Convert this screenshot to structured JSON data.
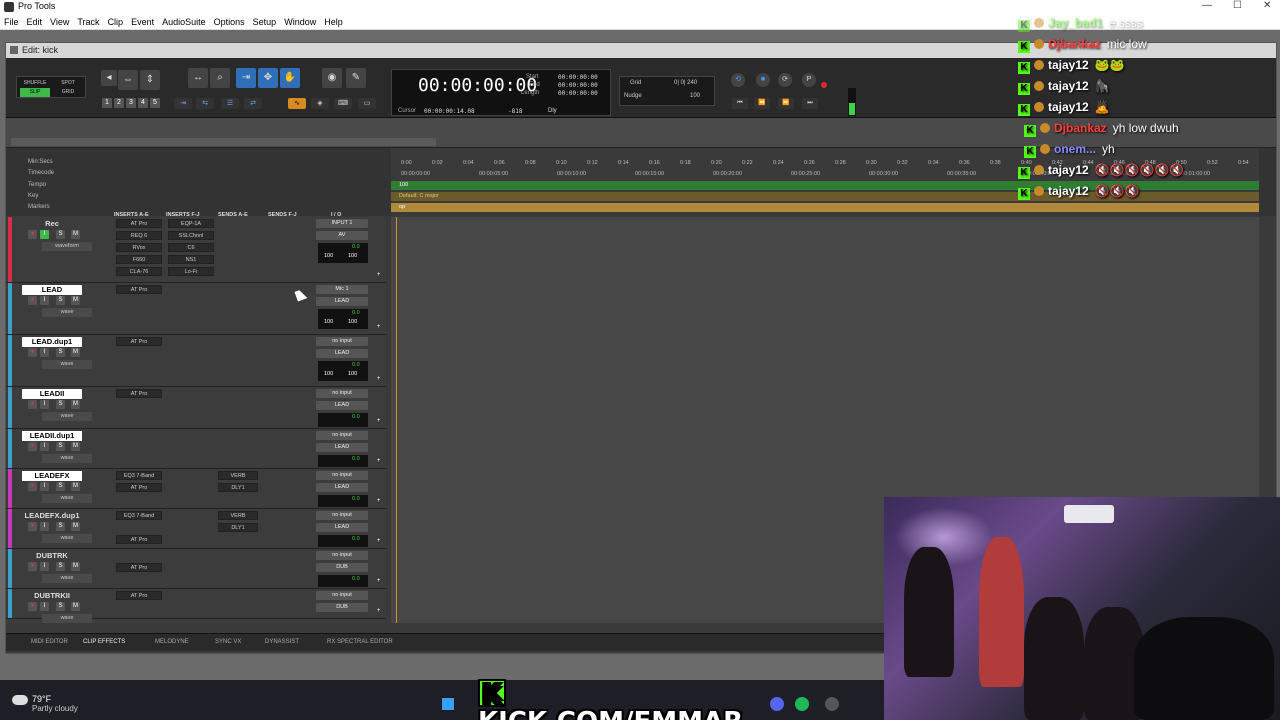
{
  "window": {
    "title": "Pro Tools",
    "minimize": "—",
    "maximize": "☐",
    "close": "✕"
  },
  "menu": [
    "File",
    "Edit",
    "View",
    "Track",
    "Clip",
    "Event",
    "AudioSuite",
    "Options",
    "Setup",
    "Window",
    "Help"
  ],
  "edit_window": {
    "title": "Edit: kick"
  },
  "modes": {
    "shuffle": "SHUFFLE",
    "spot": "SPOT",
    "slip": "SLIP",
    "grid": "GRID"
  },
  "zoom_presets": [
    "1",
    "2",
    "3",
    "4",
    "5"
  ],
  "counter": {
    "main": "00:00:00:00",
    "start_label": "Start",
    "start": "00:00:00:00",
    "end_label": "End",
    "end": "00:00:00:00",
    "length_label": "Length",
    "length": "00:00:00:00",
    "cursor_label": "Cursor",
    "cursor": "00:00:00:14.08",
    "cursor_extra": "-818",
    "dly": "Dly"
  },
  "grid": {
    "label": "Grid",
    "value": "0| 0| 240",
    "nudge_label": "Nudge",
    "nudge_value": "100"
  },
  "rulers": {
    "minsecs": "Min:Secs",
    "timecode": "Timecode",
    "tempo": "Tempo",
    "key": "Key",
    "markers": "Markers"
  },
  "timeline": {
    "minsecs_ticks": [
      "0:00",
      "0:02",
      "0:04",
      "0:06",
      "0:08",
      "0:10",
      "0:12",
      "0:14",
      "0:16",
      "0:18",
      "0:20",
      "0:22",
      "0:24",
      "0:26",
      "0:28",
      "0:30",
      "0:32",
      "0:34",
      "0:36",
      "0:38",
      "0:40",
      "0:42",
      "0:44",
      "0:46",
      "0:48",
      "0:50",
      "0:52",
      "0:54"
    ],
    "timecode_ticks": [
      "00:00:00:00",
      "00:00:05:00",
      "00:00:10:00",
      "00:00:15:00",
      "00:00:20:00",
      "00:00:25:00",
      "00:00:30:00",
      "00:00:35:00",
      "00:00:40:00",
      "00:00:55:00",
      "00:01:00:00"
    ],
    "tempo_value": "100",
    "key_value": "Default: C major",
    "marker_value": "op"
  },
  "columns": {
    "inserts_ae": "INSERTS A-E",
    "inserts_fj": "INSERTS F-J",
    "sends_ae": "SENDS A-E",
    "sends_fj": "SENDS F-J",
    "io": "I / O"
  },
  "tracks": [
    {
      "name": "Rec",
      "color": "#d92b4a",
      "ins_a": [
        "AT Pro",
        "REQ 6",
        "RVox",
        "F660",
        "CLA-76"
      ],
      "ins_f": [
        "EQP-1A",
        "SSLChnnl",
        "C6",
        "NS1",
        "Lo-Fi"
      ],
      "sends": [
        "",
        ""
      ],
      "io_in": "INPUT 1",
      "io_out": "AV",
      "vol": "0.0",
      "pan_l": "100",
      "pan_r": "100",
      "view": "waveform",
      "auto": "read",
      "dyn": "dyn",
      "plain": true
    },
    {
      "name": "LEAD",
      "color": "#3aa0c8",
      "ins_a": [
        "AT Pro"
      ],
      "ins_f": [],
      "sends": [
        "",
        ""
      ],
      "io_in": "Mic 1",
      "io_out": "LEAD",
      "vol": "0.0",
      "pan_l": "100",
      "pan_r": "100",
      "view": "wave",
      "auto": "read",
      "plain": false
    },
    {
      "name": "LEAD.dup1",
      "color": "#3aa0c8",
      "ins_a": [
        "AT Pro"
      ],
      "ins_f": [],
      "sends": [
        "",
        ""
      ],
      "io_in": "no input",
      "io_out": "LEAD",
      "vol": "0.0",
      "pan_l": "100",
      "pan_r": "100",
      "view": "wave",
      "auto": "read",
      "plain": false
    },
    {
      "name": "LEADII",
      "color": "#3aa0c8",
      "ins_a": [
        "AT Pro"
      ],
      "ins_f": [],
      "sends": [
        "",
        ""
      ],
      "io_in": "no input",
      "io_out": "LEAD",
      "vol": "0.0",
      "pan_l": "P",
      "pan_r": "P",
      "view": "wave",
      "auto": "read",
      "plain": false
    },
    {
      "name": "LEADII.dup1",
      "color": "#3aa0c8",
      "ins_a": [],
      "ins_f": [],
      "sends": [
        "",
        ""
      ],
      "io_in": "no input",
      "io_out": "LEAD",
      "vol": "0.0",
      "pan_l": "<",
      "pan_r": "0",
      "view": "wave",
      "auto": "read",
      "plain": false
    },
    {
      "name": "LEADEFX",
      "color": "#c83ab8",
      "ins_a": [
        "EQ3 7-Band",
        "AT Pro"
      ],
      "ins_f": [],
      "sends": [
        "VERB",
        "DLY1"
      ],
      "io_in": "no input",
      "io_out": "LEAD",
      "vol": "0.0",
      "pan_l": "P",
      "pan_r": "P",
      "view": "wave",
      "auto": "read",
      "plain": false
    },
    {
      "name": "LEADEFX.dup1",
      "color": "#c83ab8",
      "ins_a": [
        "EQ3 7-Band",
        "",
        "AT Pro"
      ],
      "ins_f": [],
      "sends": [
        "VERB",
        "DLY1"
      ],
      "io_in": "no input",
      "io_out": "LEAD",
      "vol": "0.0",
      "pan_l": "P",
      "pan_r": "P",
      "view": "wave",
      "auto": "read",
      "plain": true
    },
    {
      "name": "DUBTRK",
      "color": "#3aa0c8",
      "ins_a": [
        "",
        "AT Pro"
      ],
      "ins_f": [],
      "sends": [
        "",
        ""
      ],
      "io_in": "no input",
      "io_out": "DUB",
      "vol": "0.0",
      "pan_l": "P",
      "pan_r": "P",
      "view": "wave",
      "auto": "read",
      "plain": true
    },
    {
      "name": "DUBTRKII",
      "color": "#3aa0c8",
      "ins_a": [
        "AT Pro"
      ],
      "ins_f": [],
      "sends": [
        "",
        ""
      ],
      "io_in": "no input",
      "io_out": "DUB",
      "vol": "",
      "pan_l": "",
      "pan_r": "",
      "view": "wave",
      "auto": "read",
      "plain": true
    }
  ],
  "footer_tabs": [
    "MIDI EDITOR",
    "CLIP EFFECTS",
    "MELODYNE",
    "SYNC VX",
    "DYNASSIST",
    "RX SPECTRAL EDITOR"
  ],
  "chat": [
    {
      "user": "Jay_bad1",
      "msg": "e.ssss",
      "color": "#53fc18",
      "faded": true
    },
    {
      "user": "Djbankaz",
      "msg": "mic low",
      "color": "#ff3b3b"
    },
    {
      "user": "tajay12",
      "msg": "🐸🐸",
      "color": "#ffffff"
    },
    {
      "user": "tajay12",
      "msg": "🦍",
      "color": "#ffffff"
    },
    {
      "user": "tajay12",
      "msg": "🙇",
      "color": "#ffffff"
    },
    {
      "user": "Djbankaz",
      "msg": "yh low dwuh",
      "color": "#ff3b3b"
    },
    {
      "user": "onem...",
      "msg": "yh",
      "color": "#8a8aff"
    },
    {
      "user": "tajay12",
      "msg": "🔇🔇🔇🔇🔇🔇",
      "color": "#ffffff"
    },
    {
      "user": "tajay12",
      "msg": "🔇🔇🔇",
      "color": "#ffffff"
    }
  ],
  "taskbar": {
    "temp": "79°F",
    "condition": "Partly cloudy"
  },
  "banner": {
    "k": "K",
    "text": "KICK.COM/EMMAR"
  },
  "colors": {
    "accent_green": "#3fb84a",
    "kick_green": "#53fc18",
    "select_blue": "#2f6fb8"
  }
}
